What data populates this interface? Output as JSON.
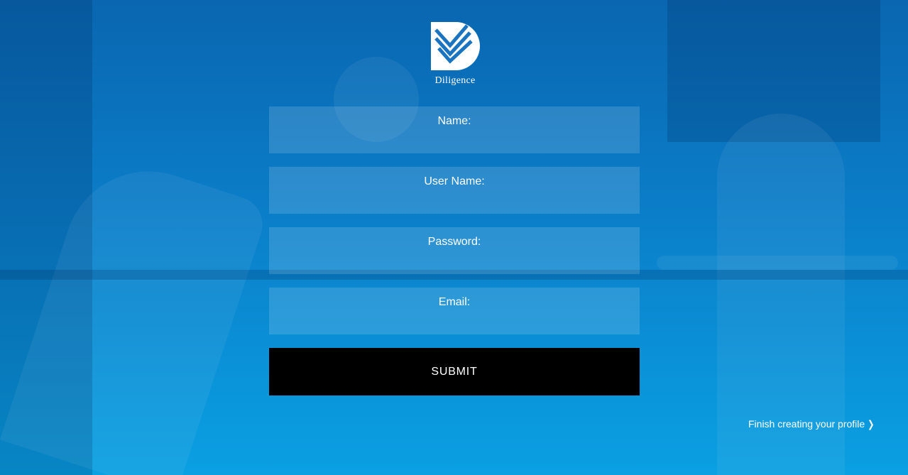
{
  "brand": {
    "name": "Diligence",
    "logo_icon": "diligence-logo-icon"
  },
  "form": {
    "fields": [
      {
        "label": "Name:",
        "value": ""
      },
      {
        "label": "User Name:",
        "value": ""
      },
      {
        "label": "Password:",
        "value": ""
      },
      {
        "label": "Email:",
        "value": ""
      }
    ],
    "submit_label": "SUBMIT"
  },
  "footer": {
    "finish_link": "Finish creating your profile",
    "finish_icon": "chevron-right-icon"
  },
  "colors": {
    "background_top": "#0a66b0",
    "background_bottom": "#0aa0e2",
    "submit_bg": "#000000",
    "text": "#ffffff"
  }
}
